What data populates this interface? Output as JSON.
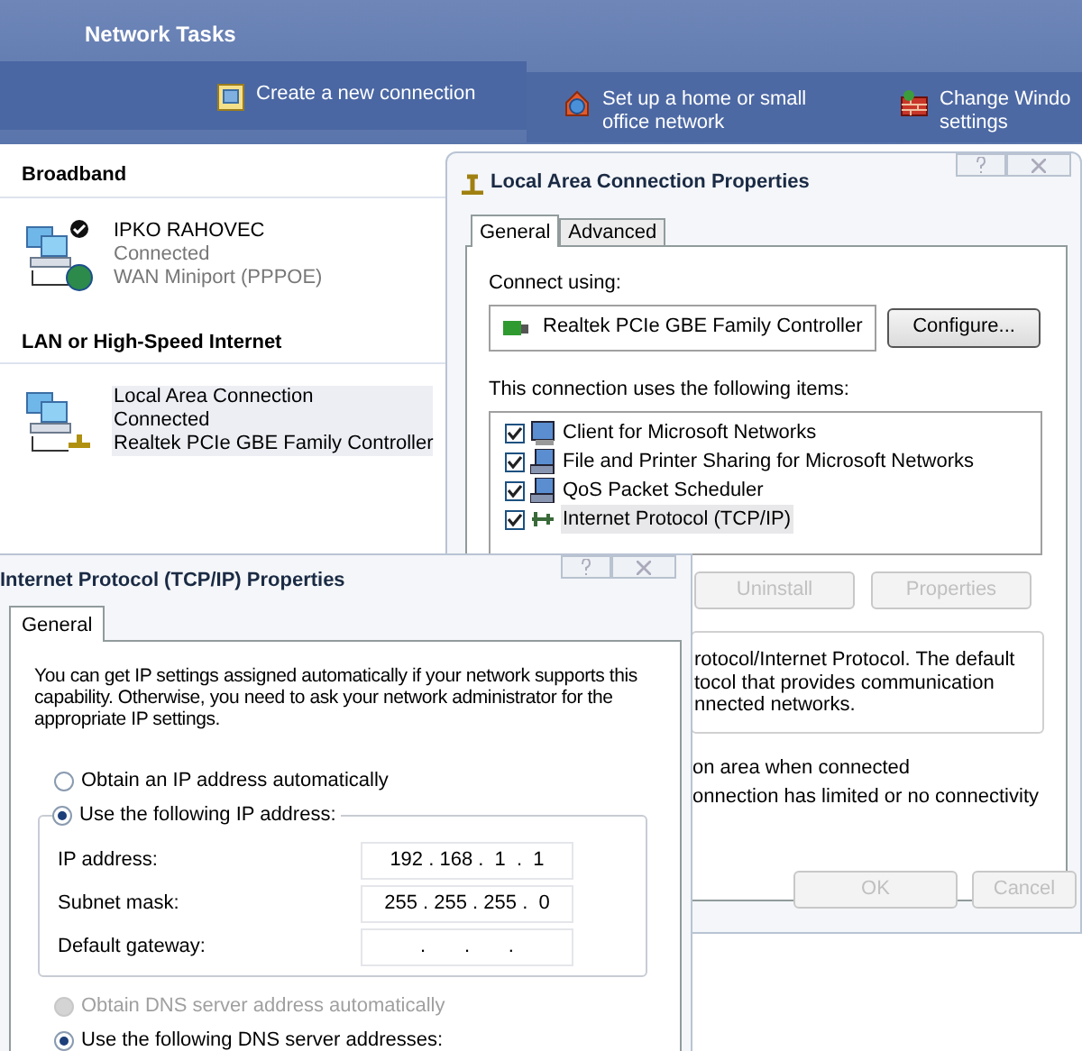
{
  "network_tasks": {
    "title": "Network Tasks",
    "tasks": [
      {
        "kind": "wizard",
        "lines": [
          "Create a new connection"
        ]
      },
      {
        "kind": "home",
        "lines": [
          "Set up a home or small",
          "office network"
        ]
      },
      {
        "kind": "firewall",
        "lines": [
          "Change Windo",
          "settings"
        ]
      }
    ]
  },
  "connections": {
    "groups": [
      {
        "heading": "Broadband",
        "items": [
          {
            "kind": "broadband",
            "selected": false,
            "name": "IPKO RAHOVEC",
            "status": "Connected",
            "device": "WAN Miniport (PPPOE)"
          }
        ]
      },
      {
        "heading": "LAN or High-Speed Internet",
        "items": [
          {
            "kind": "lan",
            "selected": true,
            "name": "Local Area Connection",
            "status": "Connected",
            "device": "Realtek PCIe GBE Family Controller"
          }
        ]
      }
    ]
  },
  "lan_properties": {
    "title": "Local Area Connection Properties",
    "tabs": [
      {
        "label": "General",
        "selected": true
      },
      {
        "label": "Advanced",
        "selected": false
      }
    ],
    "connect_using_label": "Connect using:",
    "adapter": "Realtek PCIe GBE Family Controller",
    "configure_button": "Configure...",
    "items_label": "This connection uses the following items:",
    "items": [
      {
        "kind": "client",
        "label": "Client for Microsoft Networks",
        "checked": true,
        "selected": false
      },
      {
        "kind": "service",
        "label": "File and Printer Sharing for Microsoft Networks",
        "checked": true,
        "selected": false
      },
      {
        "kind": "service",
        "label": "QoS Packet Scheduler",
        "checked": true,
        "selected": false
      },
      {
        "kind": "protocol",
        "label": "Internet Protocol (TCP/IP)",
        "checked": true,
        "selected": true
      }
    ],
    "item_buttons": [
      {
        "label": "Uninstall",
        "disabled": true
      },
      {
        "label": "Properties",
        "disabled": true
      }
    ],
    "description_lines": [
      "rotocol/Internet Protocol. The default",
      "tocol that provides communication",
      "nnected networks."
    ],
    "option_lines": [
      "on area when connected",
      "onnection has limited or no connectivity"
    ],
    "footer_buttons": [
      {
        "label": "OK",
        "disabled": true
      },
      {
        "label": "Cancel",
        "disabled": true
      }
    ]
  },
  "tcpip_properties": {
    "title": "Internet Protocol (TCP/IP) Properties",
    "tabs": [
      {
        "label": "General",
        "selected": true
      }
    ],
    "intro": "You can get IP settings assigned automatically if your network supports this capability. Otherwise, you need to ask your network administrator for the appropriate IP settings.",
    "ip_modes": [
      {
        "label": "Obtain an IP address automatically",
        "selected": false
      },
      {
        "label": "Use the following IP address:",
        "selected": true
      }
    ],
    "fields": [
      {
        "label": "IP address:",
        "value": "192 . 168 .  1  .  1"
      },
      {
        "label": "Subnet mask:",
        "value": "255 . 255 . 255 .  0"
      },
      {
        "label": "Default gateway:",
        "value": ".       .       ."
      }
    ],
    "dns_modes": [
      {
        "label": "Obtain DNS server address automatically",
        "selected": false,
        "disabled": true
      },
      {
        "label": "Use the following DNS server addresses:",
        "selected": true,
        "disabled": false
      }
    ]
  }
}
